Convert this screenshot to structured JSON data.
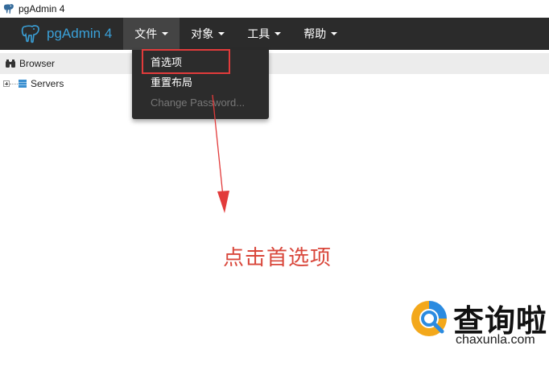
{
  "window": {
    "title": "pgAdmin 4"
  },
  "navbar": {
    "brand": "pgAdmin 4",
    "menus": [
      {
        "label": "文件",
        "active": true
      },
      {
        "label": "对象",
        "active": false
      },
      {
        "label": "工具",
        "active": false
      },
      {
        "label": "帮助",
        "active": false
      }
    ]
  },
  "file_menu": {
    "items": [
      {
        "label": "首选项",
        "highlighted": true,
        "enabled": true
      },
      {
        "label": "重置布局",
        "enabled": true
      },
      {
        "label": "Change Password...",
        "enabled": false
      }
    ]
  },
  "browser": {
    "label": "Browser",
    "tree": [
      {
        "label": "Servers",
        "expanded": false
      }
    ]
  },
  "annotation": {
    "text": "点击首选项",
    "color": "#d9473b"
  },
  "watermark": {
    "title": "查询啦",
    "domain": "chaxunla.com"
  },
  "colors": {
    "navbar_bg": "#2b2b2b",
    "brand": "#3aa0d8",
    "highlight": "#e23b3b"
  }
}
